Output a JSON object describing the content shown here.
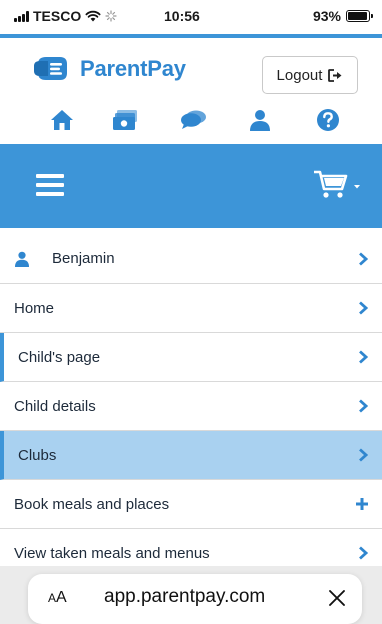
{
  "status_bar": {
    "carrier": "TESCO",
    "time": "10:56",
    "battery": "93%",
    "battery_level": 0.93
  },
  "header": {
    "brand": "ParentPay",
    "logout_label": "Logout",
    "quick_icons": [
      "home-icon",
      "payments-icon",
      "messages-icon",
      "profile-icon",
      "help-icon"
    ]
  },
  "navbar": {
    "menu_icon": "hamburger-icon",
    "cart_icon": "cart-icon"
  },
  "menu": {
    "items": [
      {
        "label": "Benjamin",
        "icon": "user-icon",
        "action": "chevron"
      },
      {
        "label": "Home",
        "action": "chevron"
      },
      {
        "label": "Child's page",
        "action": "chevron"
      },
      {
        "label": "Child details",
        "action": "chevron"
      },
      {
        "label": "Clubs",
        "action": "chevron"
      },
      {
        "label": "Book meals and places",
        "action": "plus"
      },
      {
        "label": "View taken meals and menus",
        "action": "chevron"
      }
    ]
  },
  "browser": {
    "text_size_label_small": "A",
    "text_size_label_large": "A",
    "url": "app.parentpay.com"
  },
  "colors": {
    "accent": "#3d95d8",
    "brand_text": "#2f86cf",
    "icon_blue": "#2f86cf",
    "active_row": "#a9d1f0"
  }
}
